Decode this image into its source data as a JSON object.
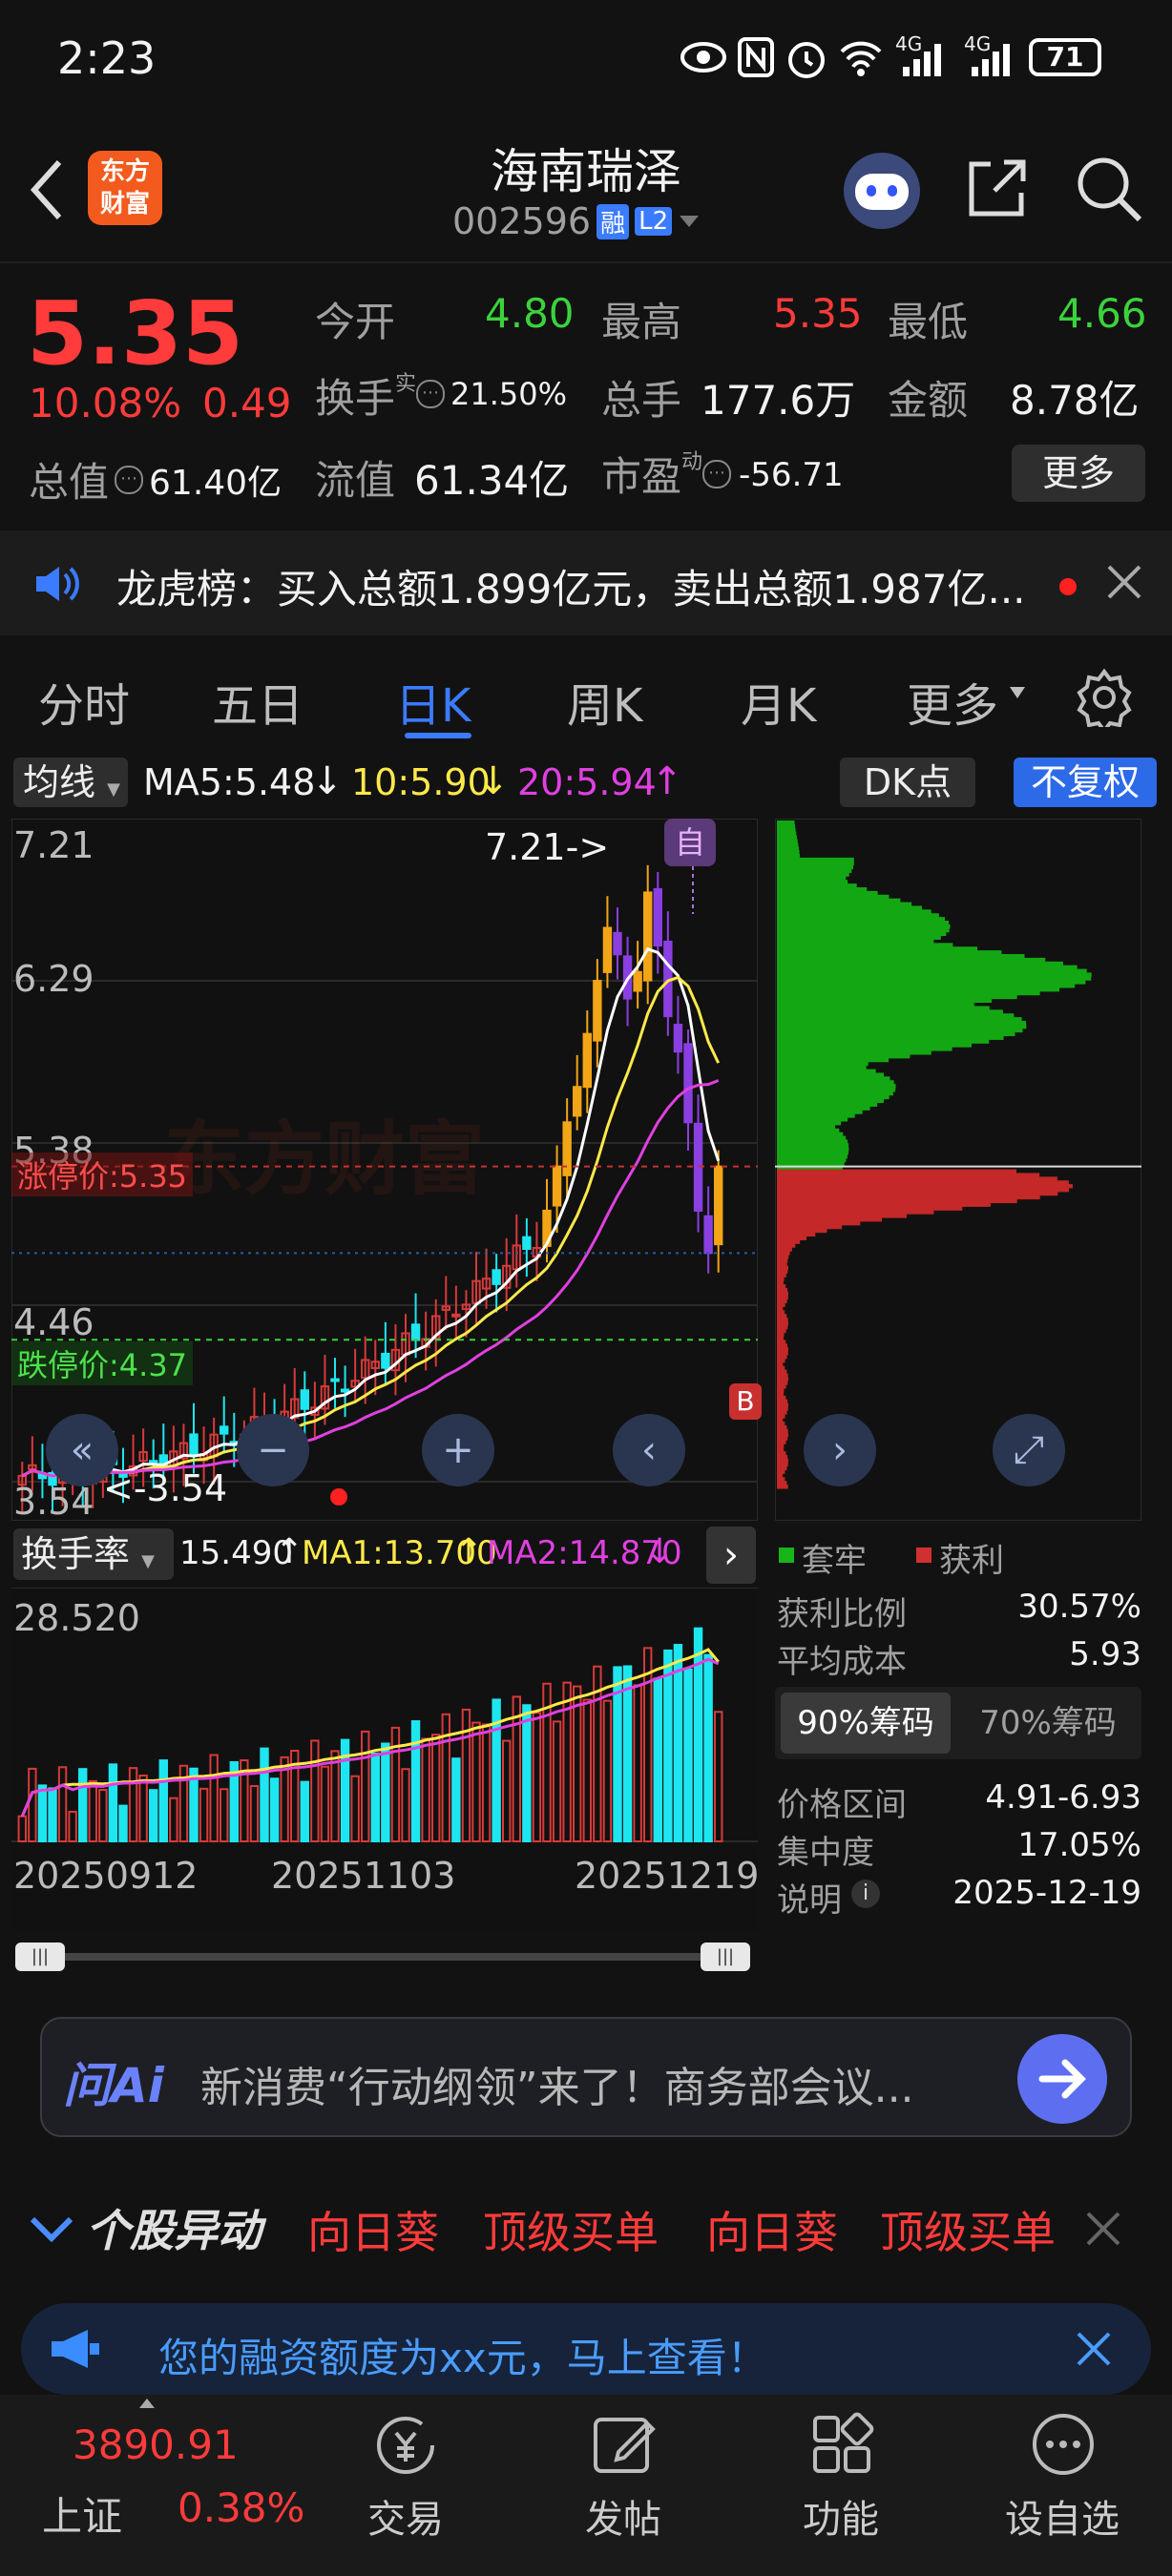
{
  "status_bar": {
    "time": "2:23",
    "battery": "71",
    "net1": "4G",
    "net2": "4G",
    "wifi_label": "6"
  },
  "header": {
    "logo_line1": "东方",
    "logo_line2": "财富",
    "stock_name": "海南瑞泽",
    "stock_code": "002596",
    "badge_rong": "融",
    "badge_l2": "L2"
  },
  "quote": {
    "price": "5.35",
    "change_pct": "10.08%",
    "change_amt": "0.49",
    "open_label": "今开",
    "open": "4.80",
    "high_label": "最高",
    "high": "5.35",
    "low_label": "最低",
    "low": "4.66",
    "turnover_label": "换手",
    "turnover_sup": "实",
    "turnover": "21.50%",
    "volume_label": "总手",
    "volume": "177.6万",
    "amount_label": "金额",
    "amount": "8.78亿",
    "mcap_label": "总值",
    "mcap": "61.40亿",
    "float_label": "流值",
    "float": "61.34亿",
    "pe_label": "市盈",
    "pe_sup": "动",
    "pe": "-56.71",
    "more": "更多"
  },
  "notice": {
    "text": "龙虎榜：买入总额1.899亿元，卖出总额1.987亿..."
  },
  "tabs": [
    "分时",
    "五日",
    "日K",
    "周K",
    "月K",
    "更多"
  ],
  "chart_bar": {
    "ma_label": "均线",
    "ma5": "MA5:5.48",
    "ma10": "10:5.90",
    "ma20": "20:5.94",
    "dk": "DK点",
    "fq": "不复权"
  },
  "chart_labels": {
    "y_max": "7.21",
    "y2": "6.29",
    "y3": "5.38",
    "y4": "4.46",
    "y_min": "3.54",
    "high_mark": "7.21->",
    "low_mark": "<-3.54",
    "auto_badge": "自",
    "limit_up": "涨停价:5.35",
    "limit_down": "跌停价:4.37",
    "b_badge": "B"
  },
  "sub_bar": {
    "label": "换手率",
    "value": "15.490",
    "ma1": "MA1:13.700",
    "ma2": "MA2:14.870",
    "top_value": "28.520"
  },
  "dates": [
    "20250912",
    "20251103",
    "20251219"
  ],
  "chip": {
    "legend_trap": "套牢",
    "legend_profit": "获利",
    "profit_ratio_label": "获利比例",
    "profit_ratio": "30.57%",
    "avg_cost_label": "平均成本",
    "avg_cost": "5.93",
    "tab90": "90%筹码",
    "tab70": "70%筹码",
    "range_label": "价格区间",
    "range": "4.91-6.93",
    "conc_label": "集中度",
    "conc": "17.05%",
    "note_label": "说明",
    "note_date": "2025-12-19"
  },
  "ai": {
    "logo": "问Ai",
    "text": "新消费“行动纲领”来了！商务部会议..."
  },
  "movers": {
    "title": "个股异动",
    "items": [
      "向日葵",
      "顶级买单",
      "向日葵",
      "顶级买单"
    ]
  },
  "promo": {
    "text": "您的融资额度为xx元，马上查看！"
  },
  "bottom_nav": {
    "index_value": "3890.91",
    "index_name": "上证",
    "index_pct": "0.38%",
    "trade": "交易",
    "post": "发帖",
    "func": "功能",
    "watch": "设自选"
  },
  "colors": {
    "up": "#ff3b3b",
    "down": "#3bd33b",
    "cyan": "#1ee6f0",
    "yellow": "#ffe94a",
    "magenta": "#e040e0",
    "accent": "#3a7bff"
  },
  "chart_data": {
    "type": "candlestick",
    "title": "",
    "y_ticks": [
      7.21,
      6.29,
      5.38,
      4.46,
      3.54
    ],
    "ylim": [
      3.54,
      7.21
    ],
    "limit_up": 5.35,
    "limit_down": 4.37,
    "series": [
      {
        "name": "MA5",
        "last": 5.48
      },
      {
        "name": "MA10",
        "last": 5.9
      },
      {
        "name": "MA20",
        "last": 5.94
      }
    ],
    "recent_closes": [
      5.1,
      5.35,
      5.6,
      5.8,
      6.1,
      6.4,
      6.7,
      6.55,
      6.3,
      6.45,
      6.9,
      6.6,
      6.2,
      6.0,
      5.6,
      5.1,
      4.86,
      5.35
    ],
    "turnover": {
      "last": 15.49,
      "ma1": 13.7,
      "ma2": 14.87,
      "max": 28.52
    },
    "chip_distribution": {
      "profit_ratio": 30.57,
      "avg_cost": 5.93,
      "range_90": [
        4.91,
        6.93
      ],
      "concentration": 17.05
    }
  }
}
